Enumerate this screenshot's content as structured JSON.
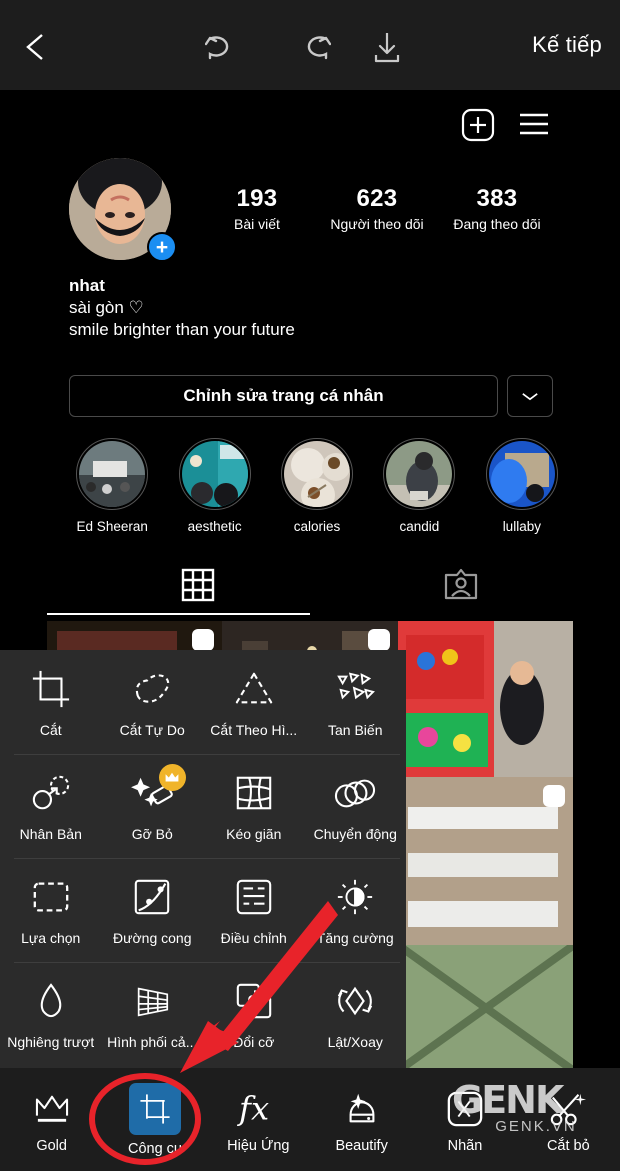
{
  "topbar": {
    "back_icon": "chevron-left-icon",
    "undo_icon": "undo-icon",
    "redo_icon": "redo-icon",
    "download_icon": "download-icon",
    "next_label": "Kế tiếp"
  },
  "instagram": {
    "plus_icon": "add-post-icon",
    "menu_icon": "hamburger-menu-icon",
    "avatar_badge": "+",
    "stats": [
      {
        "value": "193",
        "label": "Bài viết"
      },
      {
        "value": "623",
        "label": "Người theo dõi"
      },
      {
        "value": "383",
        "label": "Đang theo dõi"
      }
    ],
    "username": "nhat",
    "bio_line_1": "sài gòn ♡",
    "bio_line_2": "smile brighter than your future",
    "edit_profile_label": "Chỉnh sửa trang cá nhân",
    "chevron_icon": "chevron-down-icon",
    "highlights": [
      {
        "label": "Ed Sheeran"
      },
      {
        "label": "aesthetic"
      },
      {
        "label": "calories"
      },
      {
        "label": "candid"
      },
      {
        "label": "lullaby"
      }
    ],
    "tab_grid_icon": "grid-tab-icon",
    "tab_tagged_icon": "tagged-photos-tab-icon"
  },
  "tools_panel": {
    "rows": [
      [
        {
          "label": "Cắt",
          "icon": "crop-icon",
          "pro": false
        },
        {
          "label": "Cắt Tự Do",
          "icon": "freehand-cut-icon",
          "pro": false
        },
        {
          "label": "Cắt Theo Hì...",
          "icon": "shape-cut-icon",
          "pro": false
        },
        {
          "label": "Tan Biến",
          "icon": "dispersion-icon",
          "pro": false
        }
      ],
      [
        {
          "label": "Nhân Bản",
          "icon": "clone-icon",
          "pro": false
        },
        {
          "label": "Gỡ Bỏ",
          "icon": "remove-object-icon",
          "pro": true
        },
        {
          "label": "Kéo giãn",
          "icon": "stretch-icon",
          "pro": false
        },
        {
          "label": "Chuyển động",
          "icon": "motion-icon",
          "pro": false
        }
      ],
      [
        {
          "label": "Lựa chọn",
          "icon": "selection-icon",
          "pro": false
        },
        {
          "label": "Đường cong",
          "icon": "curves-icon",
          "pro": false
        },
        {
          "label": "Điều chỉnh",
          "icon": "adjust-icon",
          "pro": false
        },
        {
          "label": "Tăng cường",
          "icon": "enhance-icon",
          "pro": false
        }
      ],
      [
        {
          "label": "Nghiêng trượt",
          "icon": "tilt-shift-icon",
          "pro": false
        },
        {
          "label": "Hình phối cả...",
          "icon": "perspective-icon",
          "pro": false
        },
        {
          "label": "Đổi cỡ",
          "icon": "resize-icon",
          "pro": false
        },
        {
          "label": "Lật/Xoay",
          "icon": "flip-rotate-icon",
          "pro": false
        }
      ]
    ]
  },
  "bottom_nav": [
    {
      "label": "Gold",
      "icon": "crown-icon",
      "active": false
    },
    {
      "label": "Công cụ",
      "icon": "tools-crop-icon",
      "active": true
    },
    {
      "label": "Hiệu Ứng",
      "icon": "fx-icon",
      "active": false
    },
    {
      "label": "Beautify",
      "icon": "beautify-face-icon",
      "active": false
    },
    {
      "label": "Nhãn",
      "icon": "sticker-icon",
      "active": false
    },
    {
      "label": "Cắt bỏ",
      "icon": "cutout-scissors-icon",
      "active": false
    }
  ],
  "watermark": {
    "brand": "GENK",
    "domain": "GENK.VN"
  },
  "annotations": {
    "arrow_color": "#e8232a",
    "circle_color": "#e8232a",
    "highlight_color": "#1f6ca8"
  }
}
